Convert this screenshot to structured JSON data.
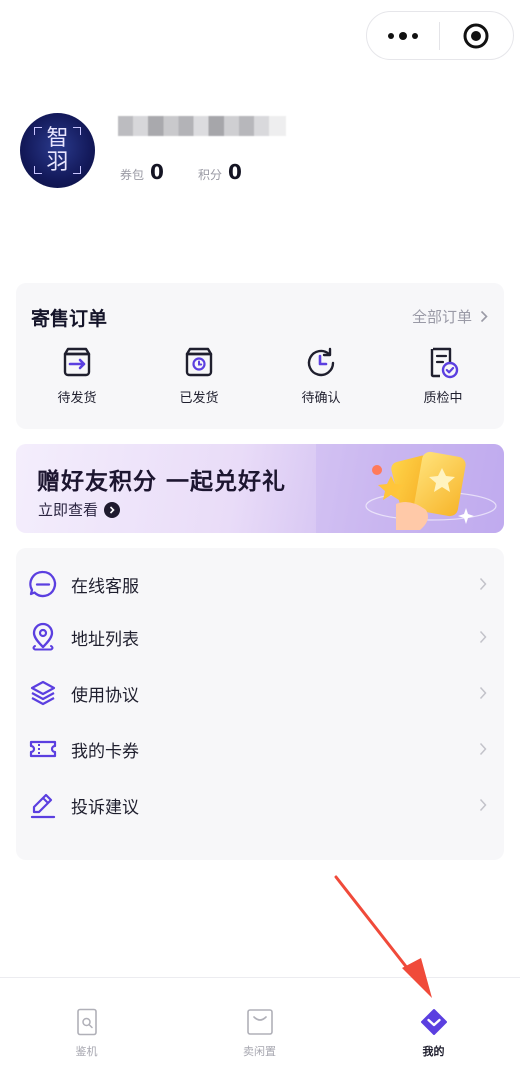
{
  "header": {
    "more_icon": "more-dots-icon",
    "close_icon": "target-icon"
  },
  "profile": {
    "avatar_text_1": "智",
    "avatar_text_2": "羽",
    "coupon_label": "券包",
    "coupon_value": "0",
    "points_label": "积分",
    "points_value": "0"
  },
  "orders": {
    "title": "寄售订单",
    "all_label": "全部订单",
    "items": [
      {
        "label": "待发货",
        "icon": "box-arrow-icon"
      },
      {
        "label": "已发货",
        "icon": "box-clock-icon"
      },
      {
        "label": "待确认",
        "icon": "clock-refresh-icon"
      },
      {
        "label": "质检中",
        "icon": "document-check-icon"
      }
    ]
  },
  "banner": {
    "title": "赠好友积分  一起兑好礼",
    "subtitle": "立即查看"
  },
  "menu": {
    "items": [
      {
        "label": "在线客服",
        "icon": "chat-icon"
      },
      {
        "label": "地址列表",
        "icon": "location-icon"
      },
      {
        "label": "使用协议",
        "icon": "layers-icon"
      },
      {
        "label": "我的卡券",
        "icon": "ticket-icon"
      },
      {
        "label": "投诉建议",
        "icon": "pencil-icon"
      }
    ]
  },
  "tabbar": {
    "items": [
      {
        "label": "鉴机",
        "icon": "phone-search-icon",
        "active": false
      },
      {
        "label": "卖闲置",
        "icon": "bag-icon",
        "active": false
      },
      {
        "label": "我的",
        "icon": "diamond-icon",
        "active": true
      }
    ]
  },
  "colors": {
    "accent": "#5b3fe0",
    "arrow": "#f04a3a",
    "card_bg": "#f7f7f9"
  }
}
